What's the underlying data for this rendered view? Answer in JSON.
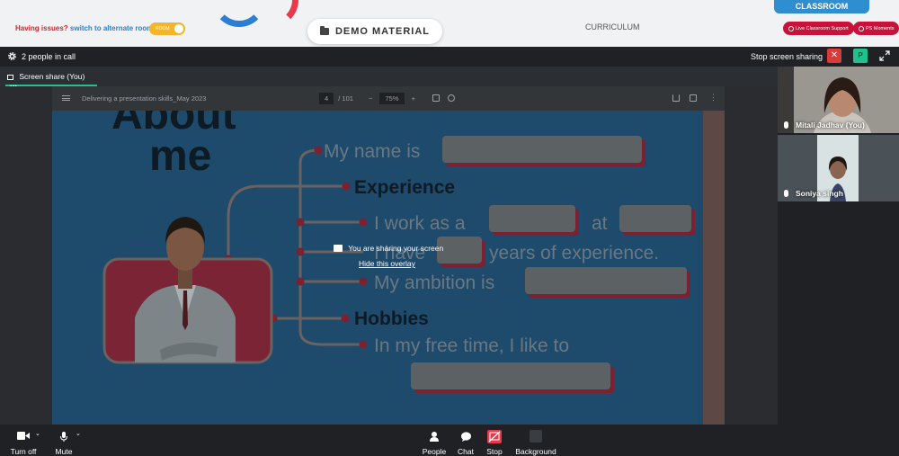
{
  "topbar": {
    "issues_text": "Having issues?",
    "alt_room_link": "switch to alternate room",
    "room_toggle": "ROOM",
    "demo_material": "DEMO MATERIAL",
    "curriculum": "CURRICULUM",
    "classroom": "CLASSROOM",
    "live_support": "Live Classroom Support",
    "ps_moments": "PS Moments"
  },
  "callbar": {
    "people_in_call": "2 people in call",
    "stop_sharing": "Stop screen sharing",
    "close_glyph": "✕",
    "p_badge": "P"
  },
  "tabbar": {
    "tab_label": "Screen share (You)",
    "more": "···"
  },
  "pdf": {
    "title": "Delivering a presentation skills_May 2023",
    "page": "4",
    "page_total": "/ 101",
    "zoom_minus": "−",
    "zoom": "75%",
    "zoom_plus": "+"
  },
  "slide": {
    "about": "About",
    "me": "me",
    "name": "My name is",
    "experience": "Experience",
    "work_as": "I work as a",
    "at": "at",
    "have": "I have",
    "years": "years of experience.",
    "ambition": "My ambition is",
    "hobbies": "Hobbies",
    "free_time": "In my free time, I like to"
  },
  "overlay": {
    "sharing": "You are sharing your screen",
    "hide": "Hide this overlay"
  },
  "participants": [
    {
      "name": "Mitali Jadhav (You)"
    },
    {
      "name": "Soniya singh"
    }
  ],
  "bottombar": {
    "turn_off": "Turn off",
    "mute": "Mute",
    "people": "People",
    "chat": "Chat",
    "stop": "Stop",
    "background": "Background"
  },
  "colors": {
    "accent_green": "#1fc28c",
    "danger_red": "#d93a3a",
    "brand_red": "#c8123a",
    "brand_blue": "#2f8ecf",
    "slide_blue": "#1e4a6b"
  }
}
